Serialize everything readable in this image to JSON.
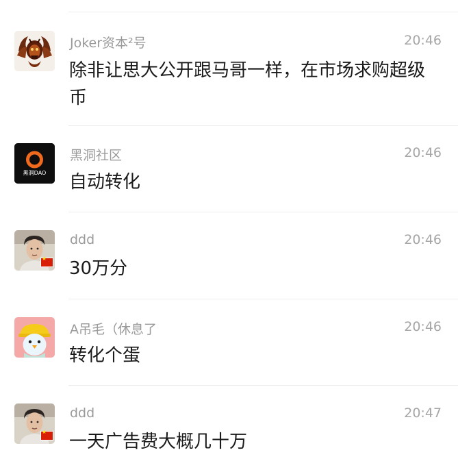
{
  "messages": [
    {
      "sender": "Joker资本²号",
      "time": "20:46",
      "text": "除非让思大公开跟马哥一样，在市场求购超级币",
      "avatar": "demon-skull-icon"
    },
    {
      "sender": "黑洞社区",
      "time": "20:46",
      "text": "自动转化",
      "avatar": "blackhole-dao-logo",
      "avatar_text": "黑洞DAO"
    },
    {
      "sender": "ddd",
      "time": "20:46",
      "text": "30万分",
      "avatar": "person-photo-icon"
    },
    {
      "sender": "A吊毛（休息了",
      "time": "20:46",
      "text": "转化个蛋",
      "avatar": "yellow-hat-bird-icon"
    },
    {
      "sender": "ddd",
      "time": "20:47",
      "text": "一天广告费大概几十万",
      "avatar": "person-photo-icon"
    }
  ],
  "colors": {
    "separator": "#ececec",
    "sender": "#9a9a9a",
    "time": "#a6a6a6",
    "text": "#1a1a1a",
    "flag": "#d81e06"
  }
}
